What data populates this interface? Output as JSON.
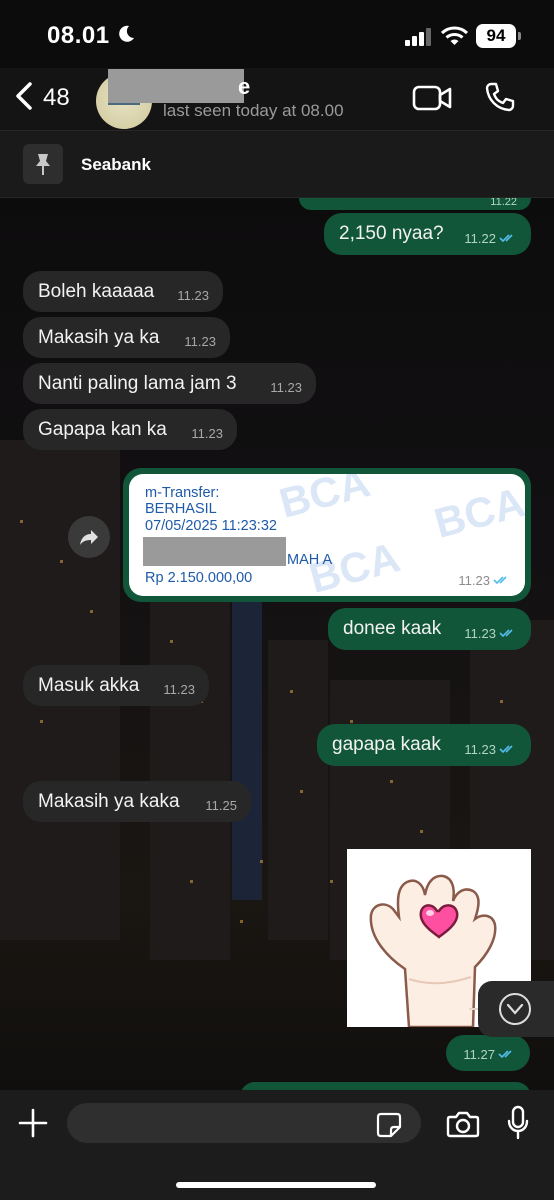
{
  "status_bar": {
    "time": "08.01",
    "battery": "94"
  },
  "header": {
    "back_count": "48",
    "contact_name_visible": "e",
    "last_seen": "last seen today at 08.00"
  },
  "pinned": {
    "label": "Seabank"
  },
  "messages": [
    {
      "dir": "out",
      "text": "2,150 nyaa?",
      "time": "11.22"
    },
    {
      "dir": "in",
      "text": "Boleh kaaaaa",
      "time": "11.23"
    },
    {
      "dir": "in",
      "text": "Makasih ya ka",
      "time": "11.23"
    },
    {
      "dir": "in",
      "text": "Nanti paling lama jam 3",
      "time": "11.23"
    },
    {
      "dir": "in",
      "text": "Gapapa kan ka",
      "time": "11.23"
    },
    {
      "dir": "out",
      "text": "donee kaak",
      "time": "11.23"
    },
    {
      "dir": "in",
      "text": "Masuk akka",
      "time": "11.23"
    },
    {
      "dir": "out",
      "text": "gapapa kaak",
      "time": "11.23"
    },
    {
      "dir": "in",
      "text": "Makasih ya kaka",
      "time": "11.25"
    }
  ],
  "transfer": {
    "line1": "m-Transfer:",
    "line2": "BERHASIL",
    "line3": "07/05/2025 11:23:32",
    "line4_visible": "MAH A",
    "amount": "Rp 2.150.000,00",
    "watermark": "BCA",
    "time": "11.23"
  },
  "sticker": {
    "time": "11.27"
  },
  "top_partial_time": "11.22",
  "colors": {
    "bubble_out": "#12563a",
    "bubble_in": "#272727",
    "tick": "#53bdeb",
    "brand": "#1e5aa8"
  }
}
